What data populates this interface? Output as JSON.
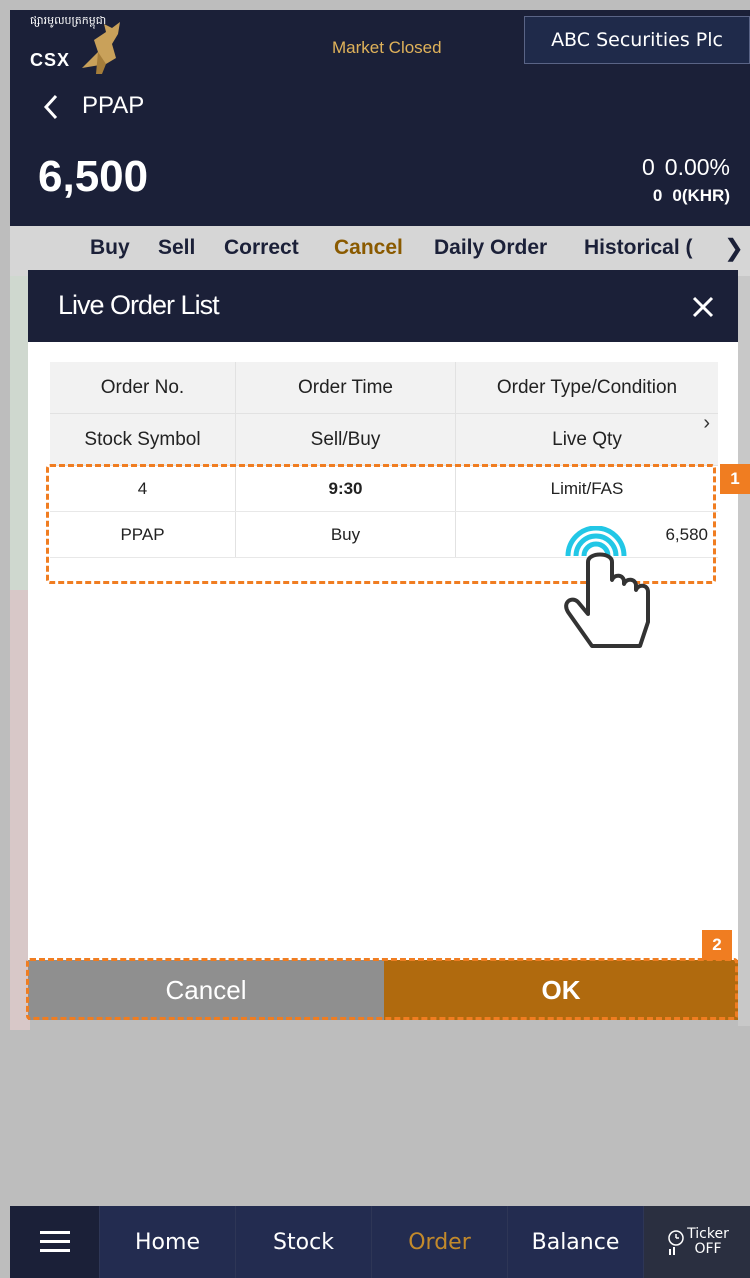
{
  "header": {
    "logo_khmer": "ផ្សារមូលបត្រកម្ពុជា",
    "logo_text": "CSX",
    "market_status": "Market Closed",
    "broker": "ABC Securities Plc"
  },
  "stock": {
    "symbol": "PPAP",
    "price": "6,500",
    "change": "0",
    "change_pct": "0.00%",
    "change2": "0",
    "change2_unit": "0(KHR)"
  },
  "tabs": [
    "Buy",
    "Sell",
    "Correct",
    "Cancel",
    "Daily Order",
    "Historical ("
  ],
  "active_tab": "Cancel",
  "dialog": {
    "title": "Live Order List",
    "headers_row1": [
      "Order No.",
      "Order Time",
      "Order Type/Condition"
    ],
    "headers_row2": [
      "Stock Symbol",
      "Sell/Buy",
      "Live Qty"
    ],
    "order": {
      "order_no": "4",
      "order_time": "9:30",
      "order_type": "Limit/FAS",
      "symbol": "PPAP",
      "side": "Buy",
      "qty": "6,580"
    },
    "cancel_label": "Cancel",
    "ok_label": "OK"
  },
  "annotations": {
    "badge1": "1",
    "badge2": "2"
  },
  "nav": {
    "home": "Home",
    "stock": "Stock",
    "order": "Order",
    "balance": "Balance",
    "ticker_line1": "Ticker",
    "ticker_line2": "OFF"
  },
  "colors": {
    "navy": "#1b2038",
    "accent_gold": "#b06a0e",
    "highlight_orange": "#f07d21",
    "buy_red": "#e0303a"
  }
}
